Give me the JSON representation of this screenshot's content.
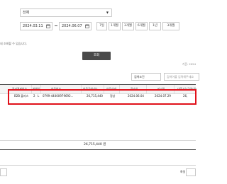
{
  "filters": {
    "type_select": "전체",
    "date_from": "2024.03.11",
    "date_to": "2024.06.07",
    "ranges": [
      "7일",
      "1개월",
      "3개월",
      "6개월",
      "1년",
      "3개월"
    ],
    "note": "내 조회할 수 있습니다.",
    "search_label": "조회",
    "info_line": "기준: 2024"
  },
  "table_controls": {
    "search_condition": "검색조건",
    "search_placeholder": "검색어를 입력해주세요"
  },
  "table": {
    "headers": [
      "전자결제번호",
      "발행인",
      "어음번호",
      "어음금액(원)",
      "어음상태",
      "접수일",
      "만기일",
      "대출가능금액(원)"
    ],
    "row": {
      "col1": "B2B 플러스",
      "col2": "2",
      "col2b": "L",
      "note_no": "0799-44000979692...",
      "amount": "26,715,440",
      "status": "정상",
      "received": "2024.06.04",
      "maturity": "2024.07.29",
      "loanable": "26,"
    }
  },
  "summary": {
    "total": "26,715,440 원"
  },
  "footer": {
    "left_box": "",
    "right_label": "화일"
  }
}
